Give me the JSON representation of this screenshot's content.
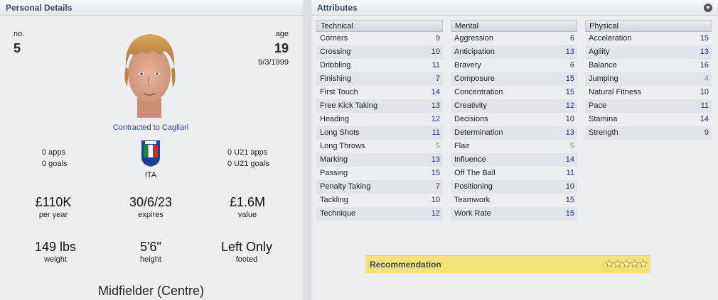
{
  "personal": {
    "header": "Personal Details",
    "no_label": "no.",
    "no_value": "5",
    "age_label": "age",
    "age_value": "19",
    "dob": "9/3/1999",
    "contract_text": "Contracted to Cagliari",
    "apps": "0 apps",
    "goals": "0 goals",
    "nationality": "ITA",
    "u21_apps": "0 U21 apps",
    "u21_goals": "0 U21 goals",
    "wage_value": "£110K",
    "wage_label": "per year",
    "expires_value": "30/6/23",
    "expires_label": "expires",
    "value_value": "£1.6M",
    "value_label": "value",
    "weight_value": "149 lbs",
    "weight_label": "weight",
    "height_value": "5'6\"",
    "height_label": "height",
    "foot_value": "Left Only",
    "foot_label": "footed",
    "position": "Midfielder (Centre)"
  },
  "attributes": {
    "header": "Attributes",
    "columns": [
      {
        "title": "Technical",
        "rows": [
          {
            "name": "Corners",
            "value": "9",
            "color": "#333333"
          },
          {
            "name": "Crossing",
            "value": "10",
            "color": "#333333"
          },
          {
            "name": "Dribbling",
            "value": "11",
            "color": "#1f2a8a"
          },
          {
            "name": "Finishing",
            "value": "7",
            "color": "#333333"
          },
          {
            "name": "First Touch",
            "value": "14",
            "color": "#1f2a8a"
          },
          {
            "name": "Free Kick Taking",
            "value": "13",
            "color": "#1f2a8a"
          },
          {
            "name": "Heading",
            "value": "12",
            "color": "#1f2a8a"
          },
          {
            "name": "Long Shots",
            "value": "11",
            "color": "#1f2a8a"
          },
          {
            "name": "Long Throws",
            "value": "5",
            "color": "#888888"
          },
          {
            "name": "Marking",
            "value": "13",
            "color": "#1f2a8a"
          },
          {
            "name": "Passing",
            "value": "15",
            "color": "#1f2a8a"
          },
          {
            "name": "Penalty Taking",
            "value": "7",
            "color": "#333333"
          },
          {
            "name": "Tackling",
            "value": "10",
            "color": "#333333"
          },
          {
            "name": "Technique",
            "value": "12",
            "color": "#1f2a8a"
          }
        ]
      },
      {
        "title": "Mental",
        "rows": [
          {
            "name": "Aggression",
            "value": "6",
            "color": "#333333"
          },
          {
            "name": "Anticipation",
            "value": "13",
            "color": "#1f2a8a"
          },
          {
            "name": "Bravery",
            "value": "6",
            "color": "#333333"
          },
          {
            "name": "Composure",
            "value": "15",
            "color": "#1f2a8a"
          },
          {
            "name": "Concentration",
            "value": "15",
            "color": "#1f2a8a"
          },
          {
            "name": "Creativity",
            "value": "12",
            "color": "#1f2a8a"
          },
          {
            "name": "Decisions",
            "value": "10",
            "color": "#333333"
          },
          {
            "name": "Determination",
            "value": "13",
            "color": "#1f2a8a"
          },
          {
            "name": "Flair",
            "value": "5",
            "color": "#888888"
          },
          {
            "name": "Influence",
            "value": "14",
            "color": "#1f2a8a"
          },
          {
            "name": "Off The Ball",
            "value": "11",
            "color": "#1f2a8a"
          },
          {
            "name": "Positioning",
            "value": "10",
            "color": "#333333"
          },
          {
            "name": "Teamwork",
            "value": "15",
            "color": "#1f2a8a"
          },
          {
            "name": "Work Rate",
            "value": "15",
            "color": "#1f2a8a"
          }
        ]
      },
      {
        "title": "Physical",
        "rows": [
          {
            "name": "Acceleration",
            "value": "15",
            "color": "#1f2a8a"
          },
          {
            "name": "Agility",
            "value": "13",
            "color": "#1f2a8a"
          },
          {
            "name": "Balance",
            "value": "16",
            "color": "#1f2a8a"
          },
          {
            "name": "Jumping",
            "value": "4",
            "color": "#888888"
          },
          {
            "name": "Natural Fitness",
            "value": "10",
            "color": "#333333"
          },
          {
            "name": "Pace",
            "value": "11",
            "color": "#1f2a8a"
          },
          {
            "name": "Stamina",
            "value": "14",
            "color": "#1f2a8a"
          },
          {
            "name": "Strength",
            "value": "9",
            "color": "#333333"
          }
        ]
      }
    ],
    "recommendation_label": "Recommendation",
    "recommendation_stars": 0
  },
  "icons": {
    "collapse": "collapse-icon",
    "flag": "italy-flag-icon",
    "star": "star-icon"
  }
}
